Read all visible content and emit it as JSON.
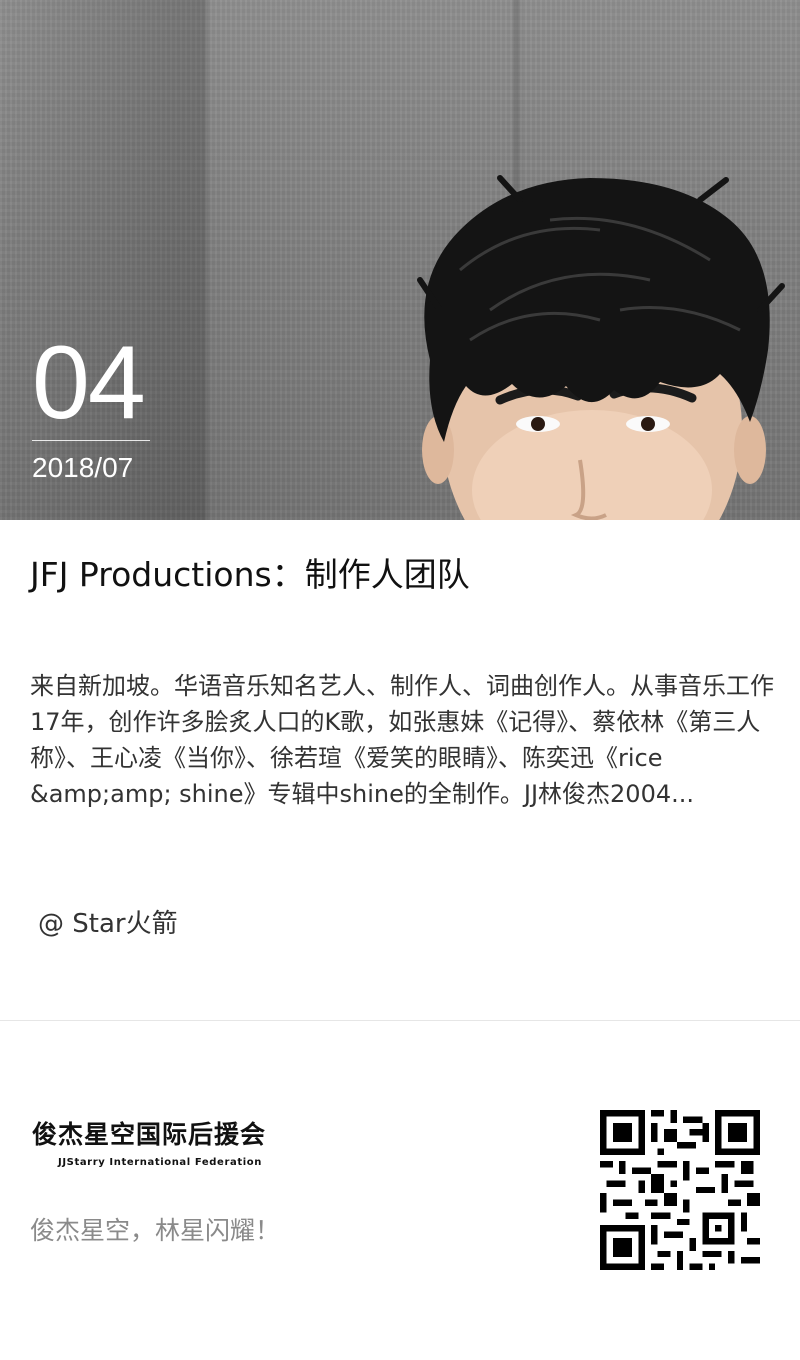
{
  "hero": {
    "day": "04",
    "month": "2018/07"
  },
  "article": {
    "title": "JFJ Productions：制作人团队",
    "excerpt": "来自新加坡。华语音乐知名艺人、制作人、词曲创作人。从事音乐工作17年，创作许多脍炙人口的K歌，如张惠妹《记得》、蔡依林《第三人称》、王心凌《当你》、徐若瑄《爱笑的眼睛》、陈奕迅《rice &amp;amp; shine》专辑中shine的全制作。JJ林俊杰2004...",
    "author": "@ Star火箭"
  },
  "footer": {
    "brand_cn": "俊杰星空国际后援会",
    "brand_en": "JJStarry International Federation",
    "slogan": "俊杰星空，林星闪耀！",
    "qr_icon": "qr-code-icon"
  },
  "colors": {
    "hero_background": "#858585",
    "text_primary": "#111111",
    "text_secondary": "#333333",
    "text_muted": "#8a8a8a",
    "divider": "#e6e6e6"
  }
}
